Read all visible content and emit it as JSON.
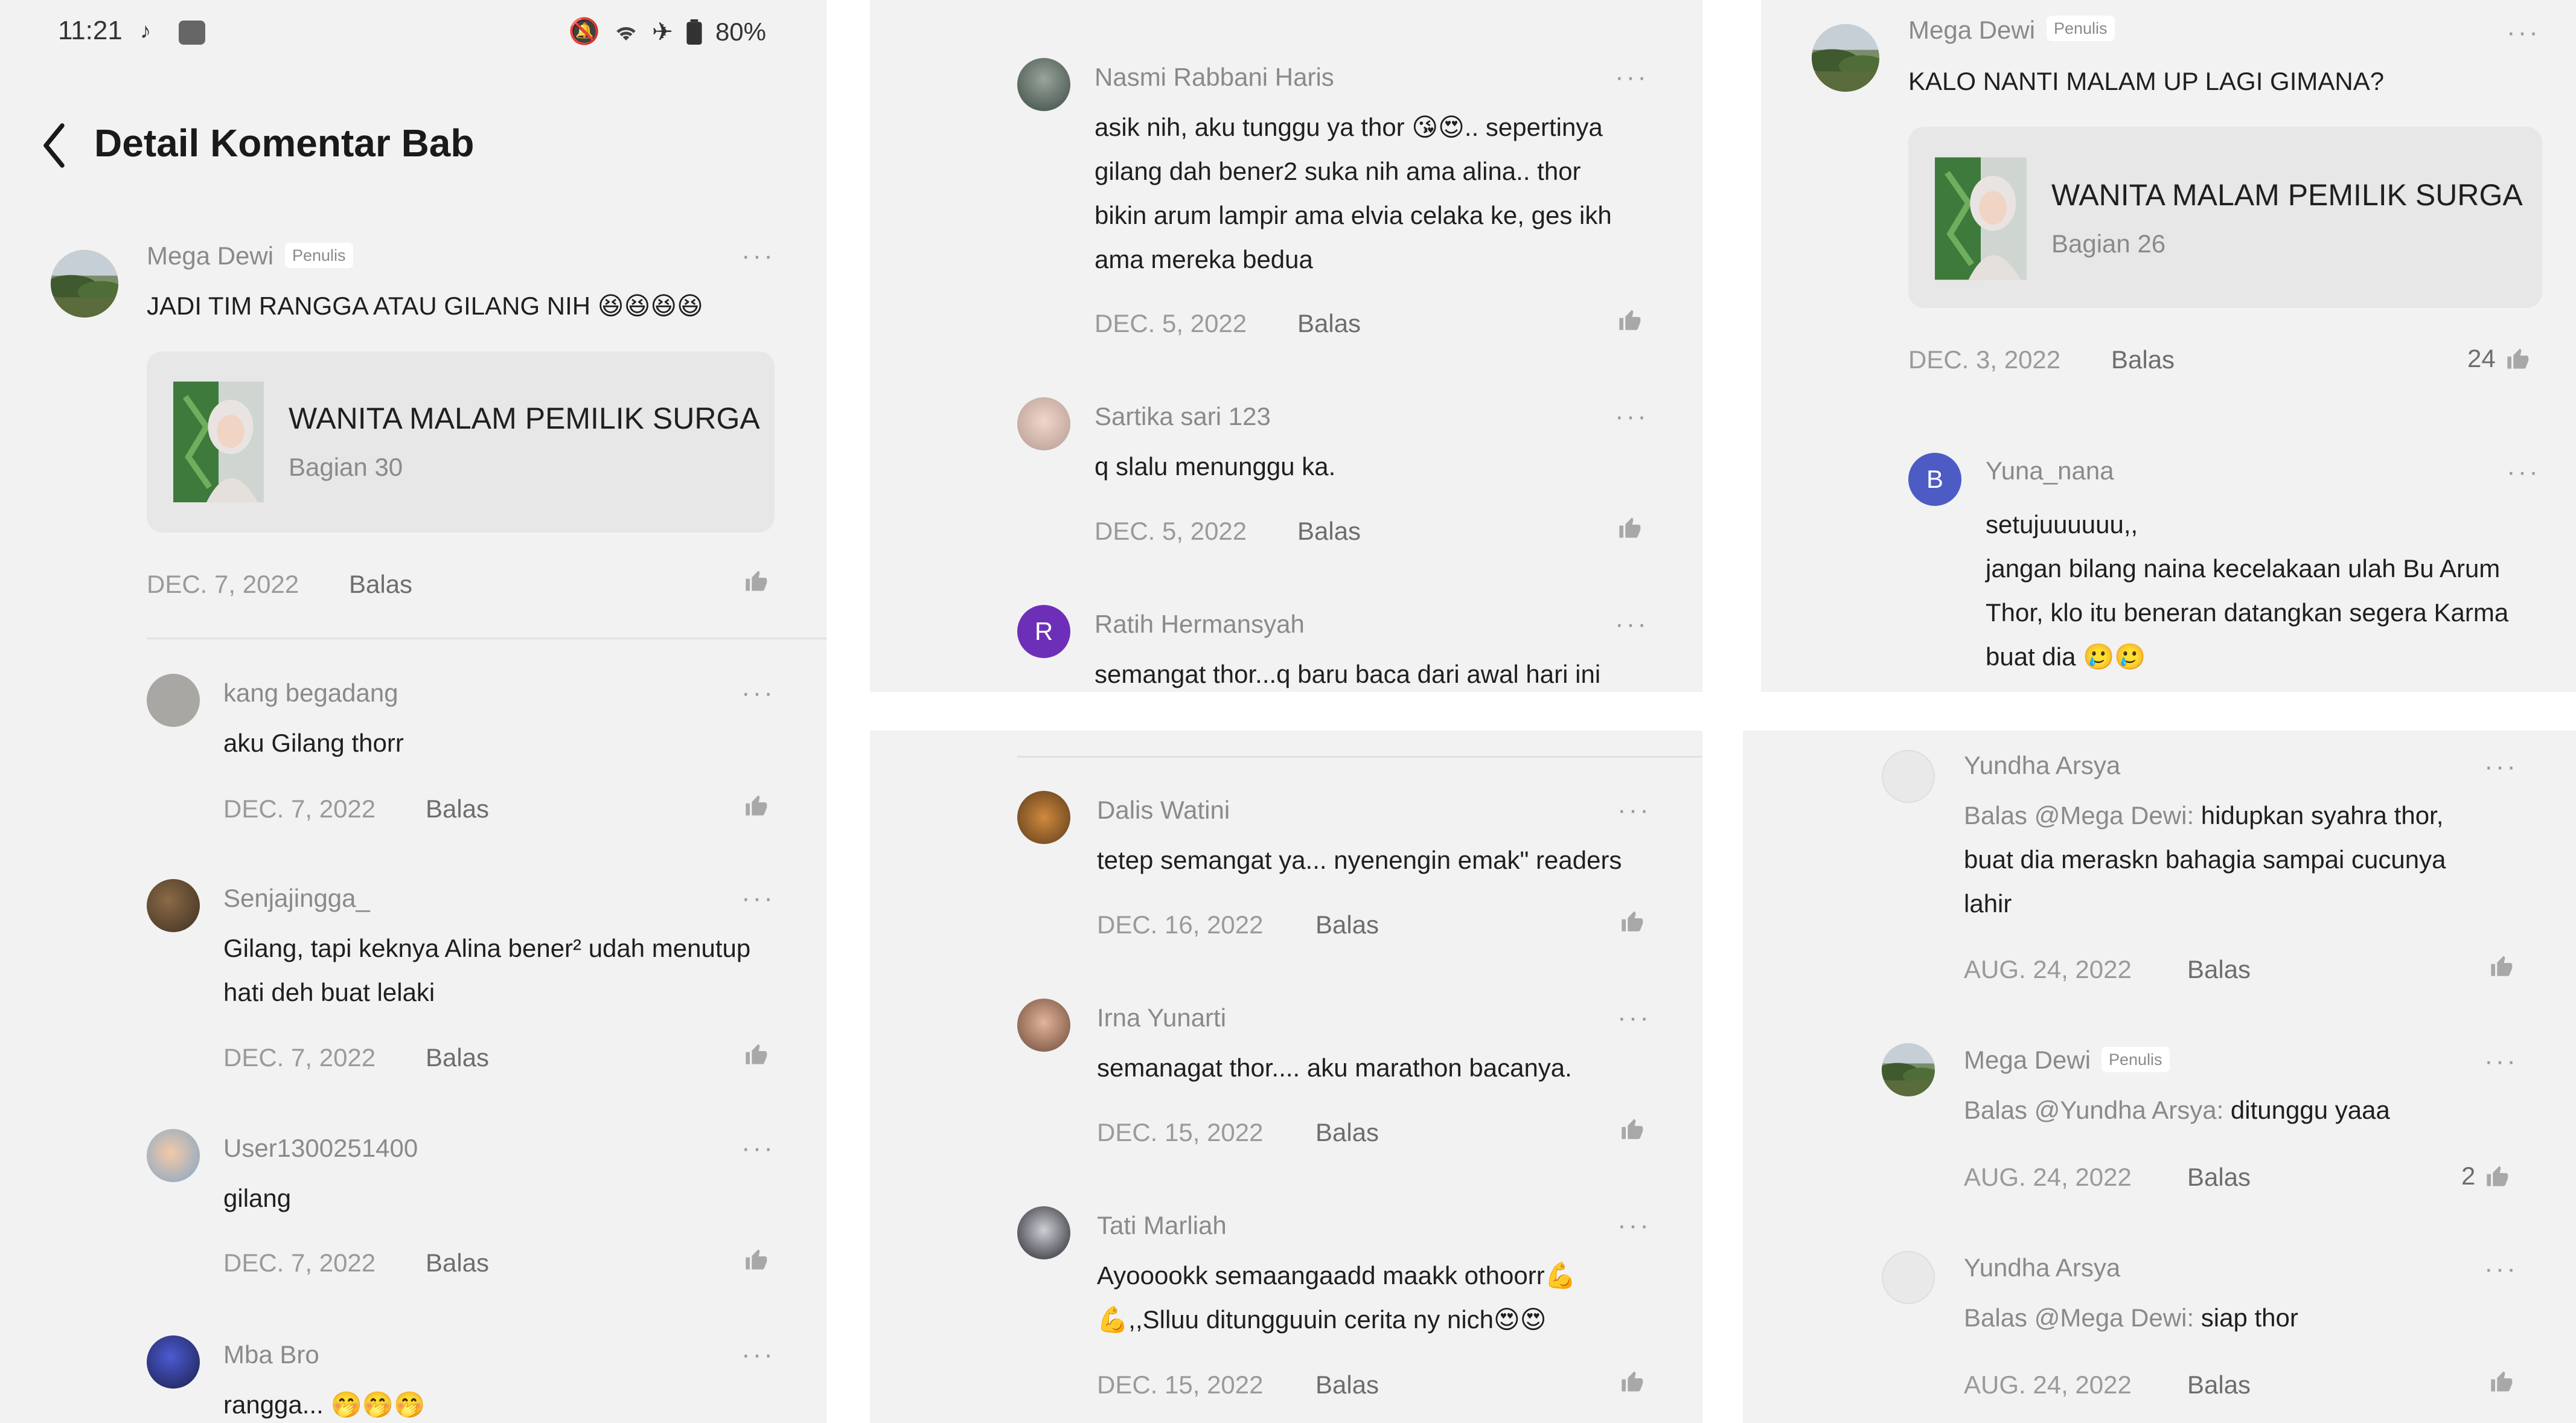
{
  "status_bar": {
    "time": "11:21",
    "battery": "80%"
  },
  "header": {
    "title": "Detail Komentar Bab"
  },
  "common": {
    "reply_label": "Balas",
    "author_badge": "Penulis"
  },
  "book": {
    "title": "WANITA MALAM PEMILIK SURGA"
  },
  "panel1": {
    "main": {
      "user": "Mega Dewi",
      "text": "JADI TIM RANGGA ATAU GILANG NIH 😆😆😆😆",
      "book_part": "Bagian 30",
      "date": "DEC. 7, 2022"
    },
    "replies": [
      {
        "user": "kang begadang",
        "lines": [
          "aku Gilang thorr"
        ],
        "date": "DEC. 7, 2022"
      },
      {
        "user": "Senjajingga_",
        "lines": [
          "Gilang, tapi keknya Alina bener² udah menutup",
          "hati deh buat lelaki"
        ],
        "date": "DEC. 7, 2022"
      },
      {
        "user": "User1300251400",
        "lines": [
          "gilang"
        ],
        "date": "DEC. 7, 2022"
      },
      {
        "user": "Mba Bro",
        "lines": [
          "rangga... 🤭🤭🤭"
        ]
      }
    ]
  },
  "panel2": {
    "comments": [
      {
        "user": "Nasmi Rabbani Haris",
        "lines": [
          "asik nih, aku tunggu ya thor 😘😍.. sepertinya",
          "gilang dah bener2 suka nih ama alina.. thor",
          "bikin arum lampir ama elvia celaka ke, ges ikh",
          "ama mereka bedua"
        ],
        "date": "DEC. 5, 2022"
      },
      {
        "user": "Sartika sari 123",
        "lines": [
          "q slalu menunggu ka."
        ],
        "date": "DEC. 5, 2022"
      },
      {
        "user": "Ratih Hermansyah",
        "avatar_letter": "R",
        "lines": [
          "semangat thor...q baru baca dari awal hari ini"
        ]
      }
    ]
  },
  "panel3": {
    "comments": [
      {
        "user": "Dalis Watini",
        "lines": [
          "tetep semangat ya... nyenengin emak\" readers"
        ],
        "date": "DEC. 16, 2022"
      },
      {
        "user": "Irna Yunarti",
        "lines": [
          "semanagat thor.... aku marathon bacanya."
        ],
        "date": "DEC. 15, 2022"
      },
      {
        "user": "Tati Marliah",
        "lines": [
          "Ayooookk semaangaadd maakk othoorr💪",
          "💪,,Slluu ditungguuin cerita ny nich😍😍"
        ],
        "date": "DEC. 15, 2022"
      }
    ]
  },
  "panel4": {
    "main": {
      "user": "Mega Dewi",
      "text": "KALO NANTI MALAM UP LAGI GIMANA?",
      "book_part": "Bagian 26",
      "date": "DEC. 3, 2022",
      "likes": "24"
    },
    "reply": {
      "user": "Yuna_nana",
      "avatar_letter": "B",
      "lines": [
        "setujuuuuuu,,",
        "jangan bilang naina kecelakaan ulah Bu Arum",
        "Thor, klo itu beneran datangkan segera Karma",
        "buat dia 🥲🥲"
      ]
    }
  },
  "panel5": {
    "replies": [
      {
        "user": "Yundha Arsya",
        "prefix": "Balas @Mega Dewi:",
        "lines": [
          " hidupkan syahra thor,",
          "buat dia meraskn bahagia sampai cucunya",
          "lahir"
        ],
        "date": "AUG. 24, 2022"
      },
      {
        "user": "Mega Dewi",
        "prefix": "Balas @Yundha Arsya:",
        "lines": [
          " ditunggu yaaa"
        ],
        "date": "AUG. 24, 2022",
        "likes": "2"
      },
      {
        "user": "Yundha Arsya",
        "prefix": "Balas @Mega Dewi:",
        "lines": [
          " siap thor"
        ],
        "date": "AUG. 24, 2022"
      }
    ]
  },
  "colors": {
    "panel_bg": "#f2f2f2",
    "card_bg": "#e7e7e7",
    "muted_text": "#8a8a8a",
    "avatar_purple": "#6e2fb8",
    "avatar_blue": "#4d5cc4"
  }
}
